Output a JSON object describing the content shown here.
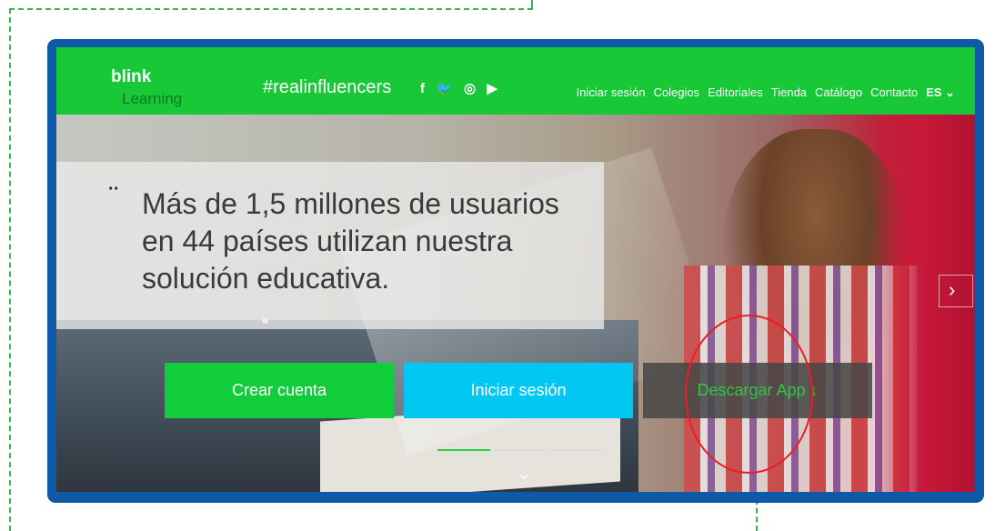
{
  "brand": {
    "logo_main": "blink",
    "logo_sub": "Learning"
  },
  "nav": {
    "hashtag": "#realinfluencers",
    "social": [
      "f",
      "🐦",
      "◎",
      "▶"
    ],
    "menu": [
      "Iniciar sesión",
      "Colegios",
      "Editoriales",
      "Tienda",
      "Catálogo",
      "Contacto"
    ],
    "language": "ES ⌄"
  },
  "hero": {
    "quote_mark": "¨",
    "headline": "Más de 1,5 millones de usuarios en 44 países utilizan nuestra solución educativa.",
    "next_arrow": "›",
    "scroll_hint": "⌄"
  },
  "cta": {
    "create": "Crear cuenta",
    "login": "Iniciar sesión",
    "download": "Descargar App ↓"
  },
  "colors": {
    "brand_green": "#18c837",
    "cta_create": "#12cd3b",
    "cta_login": "#00c8f2",
    "cta_app_bg": "#484848",
    "frame": "#0f5aa8",
    "highlight": "#ee1c24"
  },
  "carousel": {
    "slides": 3,
    "active": 0
  }
}
